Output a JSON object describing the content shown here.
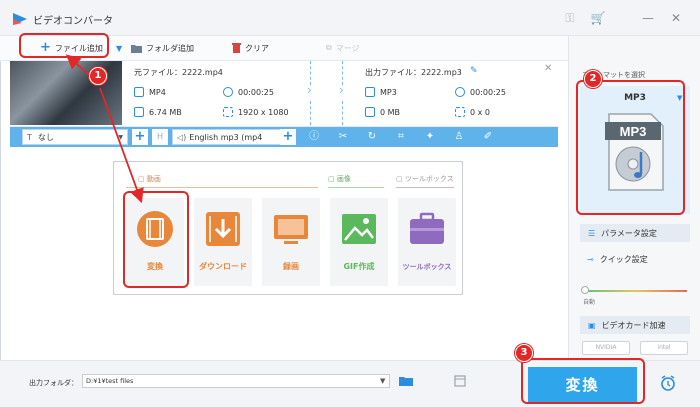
{
  "window": {
    "title": "ビデオコンバータ"
  },
  "toolbar": {
    "add_file": "ファイル追加",
    "add_folder": "フォルダ追加",
    "clear": "クリア",
    "merge": "マージ"
  },
  "file": {
    "source_label": "元ファイル：2222.mp4",
    "source_format": "MP4",
    "source_duration": "00:00:25",
    "source_size": "6.74 MB",
    "source_resolution": "1920 x 1080",
    "output_label": "出力ファイル：2222.mp3",
    "output_format": "MP3",
    "output_duration": "00:00:25",
    "output_size": "0 MB",
    "output_resolution": "0 x 0"
  },
  "editbar": {
    "subtitle_select": "なし",
    "audio_select": "English mp3 (mp4"
  },
  "panel": {
    "categories": {
      "video": "動画",
      "image": "画像",
      "toolbox": "ツールボックス"
    },
    "cards": [
      {
        "label": "変換",
        "color": "#e8873a"
      },
      {
        "label": "ダウンロード",
        "color": "#e8873a"
      },
      {
        "label": "録画",
        "color": "#e8873a"
      },
      {
        "label": "GIF作成",
        "color": "#5cb85c"
      },
      {
        "label": "ツールボックス",
        "color": "#8e6bbf"
      }
    ]
  },
  "right_panel": {
    "format_label": "フォーマットを選択",
    "format_name": "MP3",
    "format_icon_text": "MP3",
    "params_button": "パラメータ設定",
    "quick_settings": "クイック設定",
    "speed_label": "自動",
    "gpu_accel": "ビデオカード加速",
    "nvidia": "NVIDIA",
    "intel": "intel"
  },
  "bottom": {
    "output_folder_label": "出力フォルダ：",
    "output_path": "D:¥1¥test files",
    "convert_button": "変換"
  },
  "annotations": {
    "step1": "1",
    "step2": "2",
    "step3": "3"
  },
  "colors": {
    "accent": "#2fa6ec",
    "annotation": "#e32626"
  }
}
